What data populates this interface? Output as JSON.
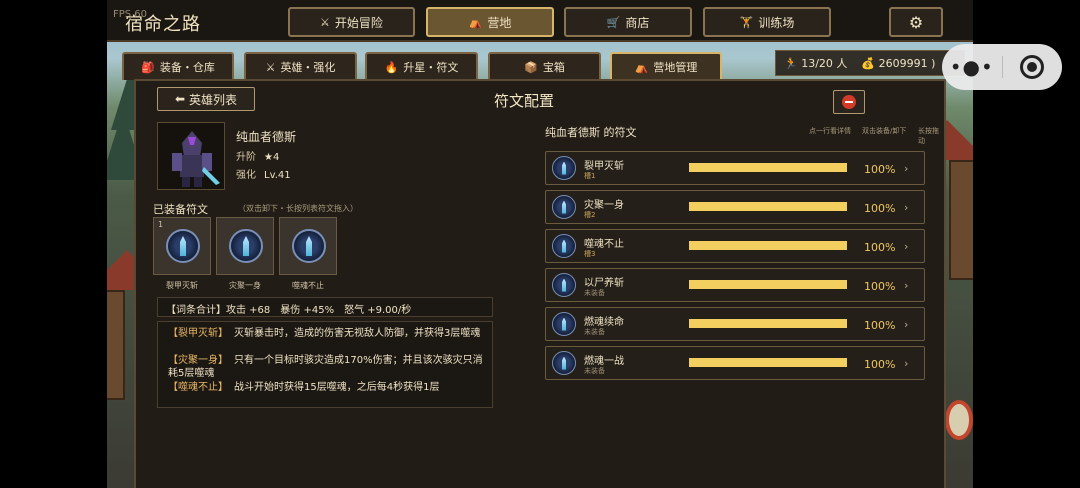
{
  "app": {
    "fps": "FPS 60",
    "title": "宿命之路"
  },
  "top_nav": [
    {
      "icon": "crossed-swords-icon",
      "label": "开始冒险",
      "active": false
    },
    {
      "icon": "camp-icon",
      "label": "营地",
      "active": true
    },
    {
      "icon": "cart-icon",
      "label": "商店",
      "active": false
    },
    {
      "icon": "dumbbell-icon",
      "label": "训练场",
      "active": false
    }
  ],
  "sub_tabs": [
    {
      "icon": "backpack-icon",
      "label": "装备・仓库"
    },
    {
      "icon": "crossed-swords-icon",
      "label": "英雄・强化"
    },
    {
      "icon": "flame-icon",
      "label": "升星・符文"
    },
    {
      "icon": "chest-icon",
      "label": "宝箱"
    },
    {
      "icon": "camp-icon",
      "label": "营地管理"
    }
  ],
  "resources": {
    "population": "13/20 人",
    "gold": "2609991 )"
  },
  "panel": {
    "back_label": "英雄列表",
    "title": "符文配置"
  },
  "hero": {
    "name": "纯血者德斯",
    "rank_label": "升阶",
    "rank_value": "★4",
    "level_label": "强化",
    "level_value": "Lv.41"
  },
  "equipped": {
    "label": "已装备符文",
    "hint": "（双击卸下・长按列表符文拖入）",
    "slots": [
      {
        "num": "1",
        "name": "裂甲灭斩"
      },
      {
        "num": "",
        "name": "灾聚一身"
      },
      {
        "num": "",
        "name": "噬魂不止"
      }
    ]
  },
  "summary": "【词条合计】攻击 +68　暴伤 +45%　怒气 +9.00/秒",
  "descriptions": [
    {
      "tag": "【裂甲灭斩】",
      "text": "灭斩暴击时，造成的伤害无视敌人防御，并获得3层噬魂"
    },
    {
      "tag": "【灾聚一身】",
      "text": "只有一个目标时骇灾造成170%伤害；并且该次骇灾只消耗5层噬魂"
    },
    {
      "tag": "【噬魂不止】",
      "text": "战斗开始时获得15层噬魂，之后每4秒获得1层"
    }
  ],
  "rune_list": {
    "title": "纯血者德斯 的符文",
    "hints": [
      "点一行看详情",
      "双击装备/卸下",
      "长按拖动"
    ],
    "items": [
      {
        "name": "裂甲灭斩",
        "slot": "槽1",
        "progress": 100,
        "percent": "100%"
      },
      {
        "name": "灾聚一身",
        "slot": "槽2",
        "progress": 100,
        "percent": "100%"
      },
      {
        "name": "噬魂不止",
        "slot": "槽3",
        "progress": 100,
        "percent": "100%"
      },
      {
        "name": "以尸养斩",
        "slot": "未装备",
        "progress": 100,
        "percent": "100%"
      },
      {
        "name": "燃魂续命",
        "slot": "未装备",
        "progress": 100,
        "percent": "100%"
      },
      {
        "name": "燃魂一战",
        "slot": "未装备",
        "progress": 100,
        "percent": "100%"
      }
    ]
  },
  "colors": {
    "accent": "#f2cf5f",
    "frame": "#d6b46a",
    "panel": "#211c16"
  }
}
